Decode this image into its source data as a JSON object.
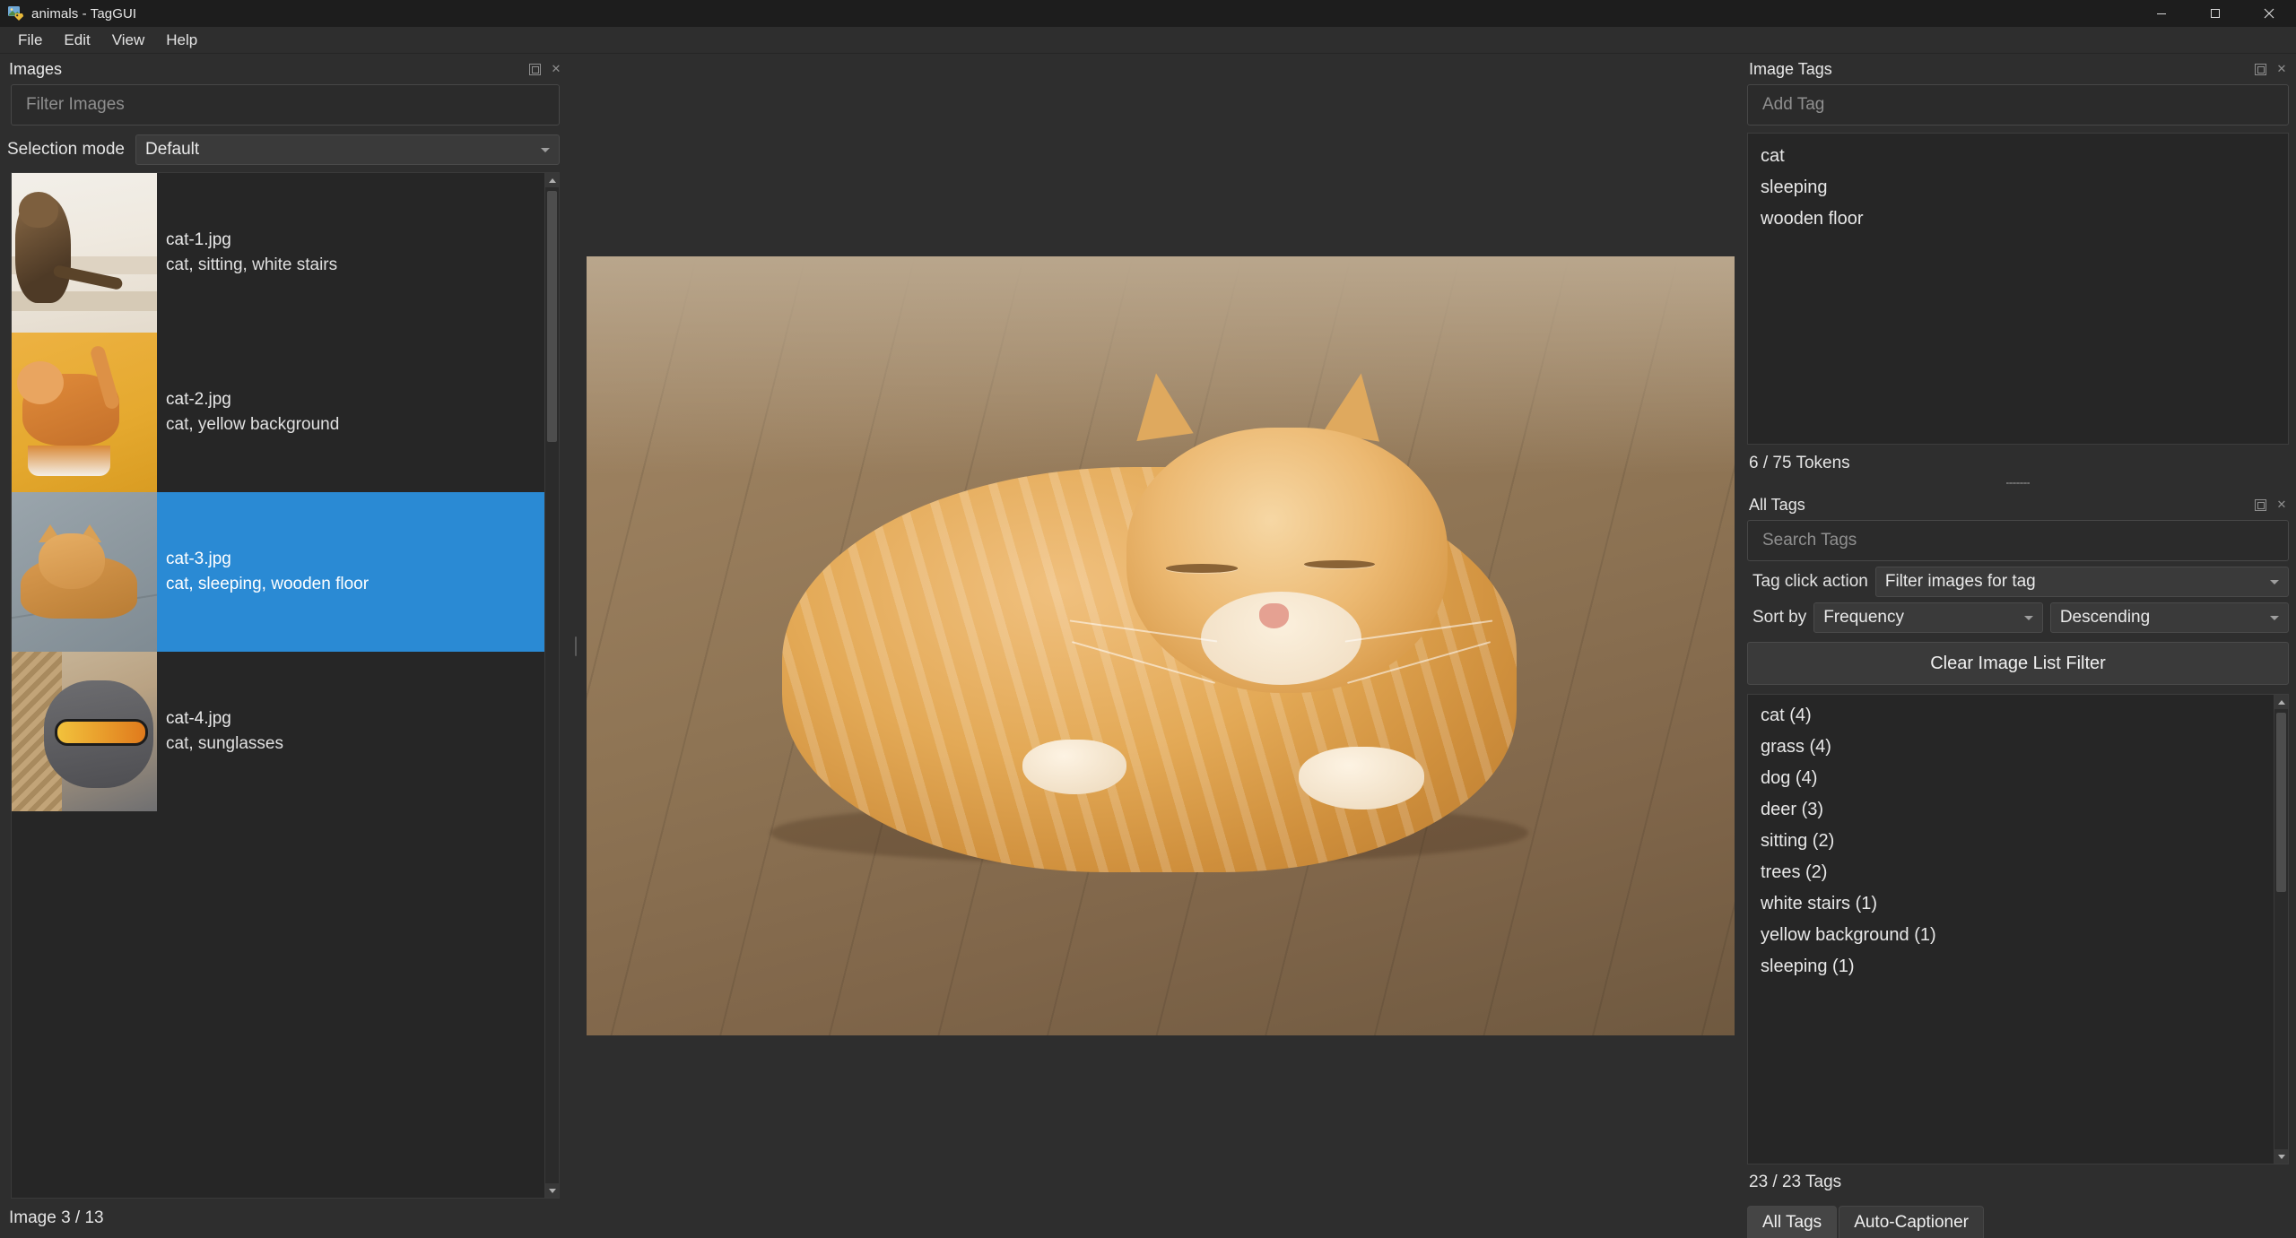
{
  "window": {
    "title": "animals - TagGUI",
    "icon": "image-tag-icon",
    "controls": {
      "minimize": "—",
      "maximize": "❐",
      "close": "✕"
    }
  },
  "menubar": {
    "items": [
      "File",
      "Edit",
      "View",
      "Help"
    ]
  },
  "images_panel": {
    "title": "Images",
    "dock_float_icon": "float-icon",
    "dock_close_icon": "close-icon",
    "filter": {
      "placeholder": "Filter Images",
      "value": ""
    },
    "selection_mode": {
      "label": "Selection mode",
      "value": "Default"
    },
    "rows": [
      {
        "name": "cat-1.jpg",
        "tags": "cat, sitting, white stairs",
        "selected": false,
        "art": "t1"
      },
      {
        "name": "cat-2.jpg",
        "tags": "cat, yellow background",
        "selected": false,
        "art": "t2"
      },
      {
        "name": "cat-3.jpg",
        "tags": "cat, sleeping, wooden floor",
        "selected": true,
        "art": "t3"
      },
      {
        "name": "cat-4.jpg",
        "tags": "cat, sunglasses",
        "selected": false,
        "art": "t4"
      }
    ],
    "status": "Image 3 / 13",
    "scroll_up_icon": "scroll-up-arrow-icon",
    "scroll_down_icon": "scroll-down-arrow-icon"
  },
  "viewer": {
    "alt": "cat-3.jpg ginger cat sleeping on wooden floor"
  },
  "image_tags_panel": {
    "title": "Image Tags",
    "dock_float_icon": "float-icon",
    "dock_close_icon": "close-icon",
    "add_tag": {
      "placeholder": "Add Tag",
      "value": ""
    },
    "tags": [
      "cat",
      "sleeping",
      "wooden floor"
    ],
    "tokens": "6 / 75 Tokens"
  },
  "all_tags_panel": {
    "title": "All Tags",
    "dock_float_icon": "float-icon",
    "dock_close_icon": "close-icon",
    "search": {
      "placeholder": "Search Tags",
      "value": ""
    },
    "tag_click_action": {
      "label": "Tag click action",
      "value": "Filter images for tag"
    },
    "sort_by": {
      "label": "Sort by",
      "value": "Frequency",
      "order": "Descending"
    },
    "clear_button": "Clear Image List Filter",
    "tags": [
      "cat (4)",
      "grass (4)",
      "dog (4)",
      "deer (3)",
      "sitting (2)",
      "trees (2)",
      "white stairs (1)",
      "yellow background (1)",
      "sleeping (1)"
    ],
    "status": "23 / 23 Tags"
  },
  "bottom_tabs": {
    "tabs": [
      "All Tags",
      "Auto-Captioner"
    ],
    "active": "All Tags"
  },
  "colors": {
    "window_bg": "#2e2e2e",
    "titlebar_bg": "#1d1d1d",
    "panel_bg": "#262626",
    "selection_blue": "#2a8ad4",
    "text": "#e8e8e8",
    "placeholder": "#8f8f8f"
  }
}
